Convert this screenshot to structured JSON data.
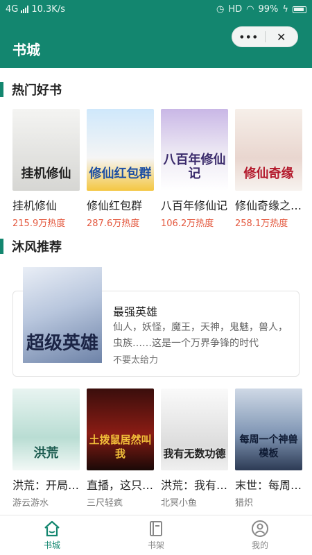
{
  "status_bar": {
    "network": "4G",
    "speed": "10.3K/s",
    "hd": "HD",
    "battery": "99%"
  },
  "header": {
    "title": "书城",
    "more_label": "•••",
    "close_label": "✕"
  },
  "sections": {
    "hot": {
      "title": "热门好书"
    },
    "recommend": {
      "title": "沐风推荐"
    }
  },
  "hot_books": [
    {
      "title": "挂机修仙",
      "heat": "215.9万热度",
      "cover_text": "挂机修仙"
    },
    {
      "title": "修仙红包群",
      "heat": "287.6万热度",
      "cover_text": "修仙红包群"
    },
    {
      "title": "八百年修仙记",
      "heat": "106.2万热度",
      "cover_text": "八百年修仙记"
    },
    {
      "title": "修仙奇缘之天境",
      "heat": "258.1万热度",
      "cover_text": "修仙奇缘"
    }
  ],
  "featured": {
    "title": "最强英雄",
    "description": "仙人，妖怪，魔王，天神，鬼魅，兽人，虫族……这是一个万界争锋的时代",
    "author": "不要太给力",
    "cover_text": "超级英雄"
  },
  "more_books": [
    {
      "title": "洪荒：开局暴击系统",
      "author": "游云游水",
      "cover_text": "洪荒"
    },
    {
      "title": "直播，这只土拨鼠",
      "author": "三尺轻疯",
      "cover_text": "土拨鼠居然叫我"
    },
    {
      "title": "洪荒：我有无数功德",
      "author": "北冥小鱼",
      "cover_text": "我有无数功德"
    },
    {
      "title": "末世：每周一个神兽",
      "author": "猎炽",
      "cover_text": "每周一个神兽模板"
    }
  ],
  "tabbar": {
    "tabs": [
      {
        "label": "书城",
        "icon": "home-icon",
        "active": true
      },
      {
        "label": "书架",
        "icon": "bookshelf-icon",
        "active": false
      },
      {
        "label": "我的",
        "icon": "user-icon",
        "active": false
      }
    ]
  },
  "colors": {
    "primary": "#13866f",
    "heat": "#e4593f"
  }
}
